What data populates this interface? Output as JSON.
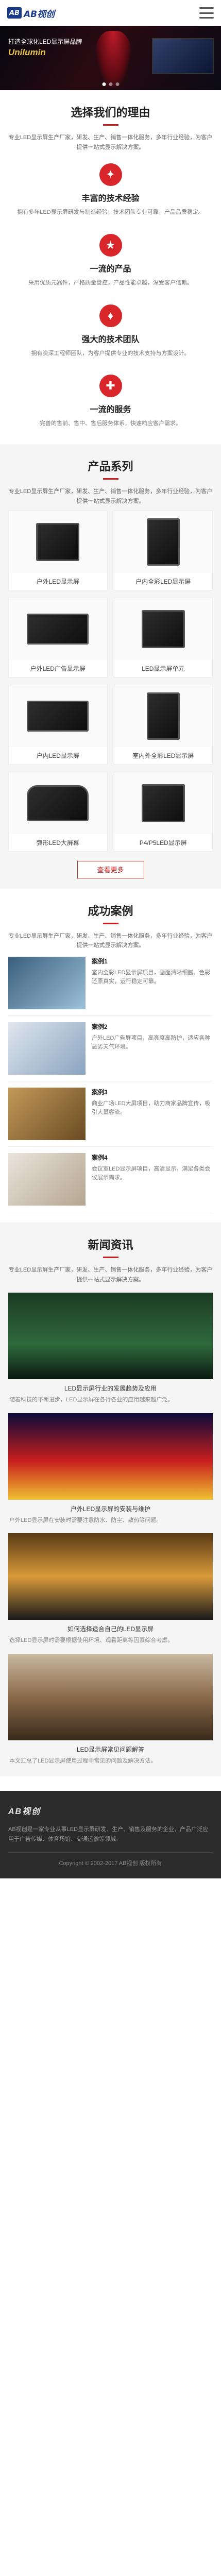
{
  "header": {
    "logo_mark": "AB",
    "logo_text": "AB视创"
  },
  "banner": {
    "line1": "打造全球化LED显示屏品牌",
    "line2": "Unilumin"
  },
  "reasons": {
    "title": "选择我们的理由",
    "intro": "专业LED显示屏生产厂家，研发、生产、销售一体化服务，多年行业经验，为客户提供一站式显示解决方案。",
    "items": [
      {
        "icon": "✦",
        "title": "丰富的技术经验",
        "desc": "拥有多年LED显示屏研发与制造经验，技术团队专业可靠，产品品质稳定。"
      },
      {
        "icon": "★",
        "title": "一流的产品",
        "desc": "采用优质元器件，严格质量管控，产品性能卓越，深受客户信赖。"
      },
      {
        "icon": "♦",
        "title": "强大的技术团队",
        "desc": "拥有资深工程师团队，为客户提供专业的技术支持与方案设计。"
      },
      {
        "icon": "✚",
        "title": "一流的服务",
        "desc": "完善的售前、售中、售后服务体系，快速响应客户需求。"
      }
    ]
  },
  "products": {
    "title": "产品系列",
    "intro": "专业LED显示屏生产厂家，研发、生产、销售一体化服务，多年行业经验，为客户提供一站式显示解决方案。",
    "items": [
      {
        "name": "户外LED显示屏"
      },
      {
        "name": "户内全彩LED显示屏"
      },
      {
        "name": "户外LED广告显示屏"
      },
      {
        "name": "LED显示屏单元"
      },
      {
        "name": "户内LED显示屏"
      },
      {
        "name": "室内外全彩LED显示屏"
      },
      {
        "name": "弧形LED大屏幕"
      },
      {
        "name": "P4/P5LED显示屏"
      }
    ],
    "more": "查看更多"
  },
  "cases": {
    "title": "成功案例",
    "intro": "专业LED显示屏生产厂家，研发、生产、销售一体化服务，多年行业经验，为客户提供一站式显示解决方案。",
    "items": [
      {
        "title": "案例1",
        "desc": "室内全彩LED显示屏项目，画面清晰细腻，色彩还原真实，运行稳定可靠。"
      },
      {
        "title": "案例2",
        "desc": "户外LED广告屏项目，高亮度高防护，适应各种恶劣天气环境。"
      },
      {
        "title": "案例3",
        "desc": "商业广场LED大屏项目，助力商家品牌宣传，吸引大量客流。"
      },
      {
        "title": "案例4",
        "desc": "会议室LED显示屏项目，高清显示，满足各类会议展示需求。"
      }
    ]
  },
  "news": {
    "title": "新闻资讯",
    "intro": "专业LED显示屏生产厂家，研发、生产、销售一体化服务，多年行业经验，为客户提供一站式显示解决方案。",
    "items": [
      {
        "caption": "LED显示屏行业的发展趋势及应用",
        "desc": "随着科技的不断进步，LED显示屏在各行各业的应用越来越广泛。"
      },
      {
        "caption": "户外LED显示屏的安装与维护",
        "desc": "户外LED显示屏在安装时需要注意防水、防尘、散热等问题。"
      },
      {
        "caption": "如何选择适合自己的LED显示屏",
        "desc": "选择LED显示屏时需要根据使用环境、观看距离等因素综合考虑。"
      },
      {
        "caption": "LED显示屏常见问题解答",
        "desc": "本文汇总了LED显示屏使用过程中常见的问题及解决方法。"
      }
    ]
  },
  "footer": {
    "logo": "AB视创",
    "text": "AB视创是一家专业从事LED显示屏研发、生产、销售及服务的企业，产品广泛应用于广告传媒、体育场馆、交通运输等领域。",
    "copyright": "Copyright © 2002-2017 AB视创 版权所有"
  }
}
